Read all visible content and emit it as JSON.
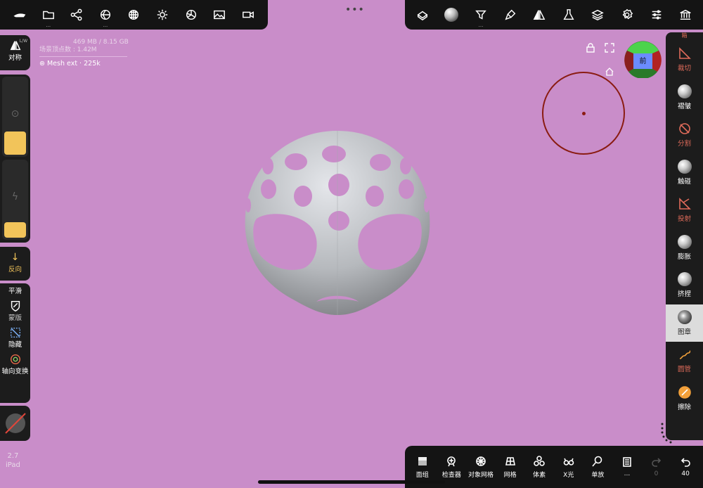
{
  "top_left_tools": [
    {
      "name": "nomad-logo-icon"
    },
    {
      "name": "folder-icon",
      "dots": "..."
    },
    {
      "name": "share-icon"
    },
    {
      "name": "scene-icon",
      "dots": "..."
    },
    {
      "name": "material-icon"
    },
    {
      "name": "light-icon"
    },
    {
      "name": "postprocess-icon"
    },
    {
      "name": "background-image-icon"
    },
    {
      "name": "camera-icon"
    }
  ],
  "top_right_tools": [
    {
      "name": "topology-icon"
    },
    {
      "name": "matcap-icon"
    },
    {
      "name": "filter-icon",
      "dots": "..."
    },
    {
      "name": "paint-icon"
    },
    {
      "name": "symmetry-icon"
    },
    {
      "name": "flask-icon"
    },
    {
      "name": "layers-icon"
    },
    {
      "name": "settings-icon"
    },
    {
      "name": "sliders-icon"
    },
    {
      "name": "museum-icon"
    }
  ],
  "stats": {
    "memory": "469 MB / 8.15 GB",
    "vertices": "场景顶点数 : 1.42M",
    "mesh": "Mesh ext · 225k"
  },
  "left_panel": {
    "symmetry_label": "对称",
    "symmetry_tag": "L/W",
    "invert_label": "反向",
    "smooth_label": "平滑",
    "mask_label": "蒙版",
    "hide_label": "隐藏",
    "gizmo_label": "轴向变换"
  },
  "right_tools": [
    {
      "name": "tool-clip",
      "label": "裁切",
      "state": "dim"
    },
    {
      "name": "tool-crease",
      "label": "褶皱",
      "state": "normal"
    },
    {
      "name": "tool-split",
      "label": "分割",
      "state": "dim"
    },
    {
      "name": "tool-move",
      "label": "触碰",
      "state": "normal"
    },
    {
      "name": "tool-project",
      "label": "投射",
      "state": "dim"
    },
    {
      "name": "tool-inflate",
      "label": "膨胀",
      "state": "normal"
    },
    {
      "name": "tool-pinch",
      "label": "挤捏",
      "state": "normal"
    },
    {
      "name": "tool-stamp",
      "label": "图章",
      "state": "selected"
    },
    {
      "name": "tool-tube",
      "label": "圆管",
      "state": "dim"
    },
    {
      "name": "tool-erase",
      "label": "擦除",
      "state": "normal"
    }
  ],
  "right_top_label": "箱",
  "bottom_tools": [
    {
      "name": "facegroup-button",
      "label": "面组"
    },
    {
      "name": "inspector-button",
      "label": "检查器"
    },
    {
      "name": "object-mesh-button",
      "label": "对象网格"
    },
    {
      "name": "wireframe-button",
      "label": "网格"
    },
    {
      "name": "voxel-button",
      "label": "体素"
    },
    {
      "name": "xray-button",
      "label": "X光"
    },
    {
      "name": "solo-button",
      "label": "单放"
    },
    {
      "name": "history-button",
      "label": "..."
    },
    {
      "name": "redo-button",
      "label": "0"
    },
    {
      "name": "undo-button",
      "label": "40"
    }
  ],
  "view_cube_label": "前",
  "version": {
    "number": "2.7",
    "device": "iPad"
  },
  "colors": {
    "background": "#c98dc9",
    "accent": "#f2c45a",
    "brush_ring": "#8a1c12",
    "panel": "#141414"
  }
}
